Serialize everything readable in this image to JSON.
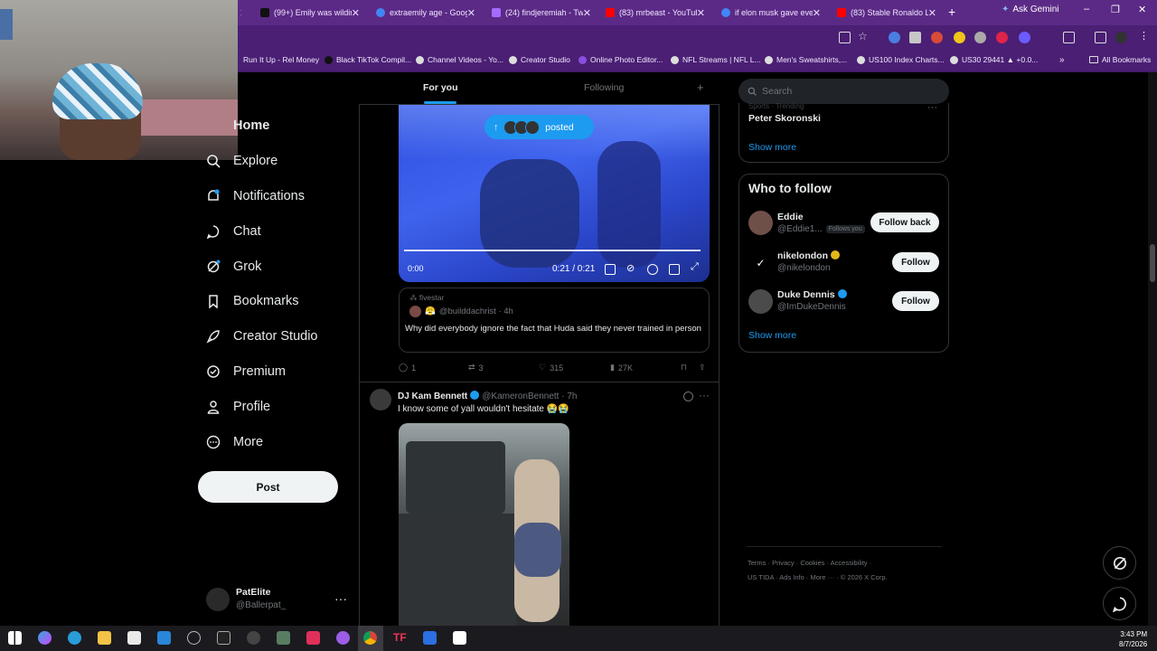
{
  "browser": {
    "tabs": [
      {
        "title": "(99+) Emily was wildin",
        "color": "#ffffff"
      },
      {
        "title": "extraemily age - Goog",
        "color": "#4285f4"
      },
      {
        "title": "(24) findjeremiah - Tw",
        "color": "#a46bff"
      },
      {
        "title": "(83) mrbeast - YouTub",
        "color": "#ff0000"
      },
      {
        "title": "if elon musk gave ever",
        "color": "#4285f4"
      },
      {
        "title": "(83) Stable Ronaldo Li",
        "color": "#ff0000"
      }
    ],
    "ask_gemini": "Ask Gemini",
    "bookmarks": [
      "Run It Up - Rel Money",
      "Black TikTok Compil...",
      "Channel Videos - Yo...",
      "Creator Studio",
      "Online Photo Editor...",
      "NFL Streams | NFL L...",
      "Men's Sweatshirts,...",
      "US100 Index Charts...",
      "US30 29441 ▲ +0.0...",
      "All Bookmarks"
    ]
  },
  "nav": {
    "items": [
      {
        "label": "Home",
        "icon": "home-icon"
      },
      {
        "label": "Explore",
        "icon": "search-icon"
      },
      {
        "label": "Notifications",
        "icon": "bell-icon",
        "badge": "1"
      },
      {
        "label": "Chat",
        "icon": "chat-icon"
      },
      {
        "label": "Grok",
        "icon": "grok-icon"
      },
      {
        "label": "Bookmarks",
        "icon": "bookmark-icon"
      },
      {
        "label": "Creator Studio",
        "icon": "rocket-icon"
      },
      {
        "label": "Premium",
        "icon": "verified-icon"
      },
      {
        "label": "Profile",
        "icon": "person-icon"
      },
      {
        "label": "More",
        "icon": "more-circle-icon"
      }
    ],
    "post_label": "Post",
    "account": {
      "name": "PatElite",
      "handle": "@Ballerpat_"
    }
  },
  "feed": {
    "tabs": {
      "for_you": "For you",
      "following": "Following",
      "add": "+"
    },
    "posted_pill": "posted",
    "video": {
      "time": "0:21 / 0:21",
      "start": "0:00"
    },
    "quote": {
      "context": "fivestar",
      "user": "@builddachrist · 4h",
      "text": "Why did everybody ignore the fact that Huda said they never trained in person"
    },
    "actions": {
      "replies": "1",
      "reposts": "3",
      "likes": "315",
      "views": "27K"
    },
    "tweet": {
      "name": "DJ Kam Bennett",
      "handle": "@KameronBennett · 7h",
      "text": "I know some of yall wouldn't hesitate 😭😭"
    }
  },
  "right": {
    "search_placeholder": "Search",
    "trend": {
      "subtitle": "Sports · Trending",
      "name": "Peter Skoronski"
    },
    "show_more": "Show more",
    "who_to_follow": {
      "title": "Who to follow",
      "users": [
        {
          "name": "Eddie",
          "handle": "@Eddie1...",
          "follows_you": "Follows you",
          "button": "Follow back",
          "verified": false
        },
        {
          "name": "nikelondon",
          "handle": "@nikelondon",
          "button": "Follow",
          "verified": true
        },
        {
          "name": "Duke Dennis",
          "handle": "@ImDukeDennis",
          "button": "Follow",
          "verified": true
        }
      ],
      "show_more": "Show more"
    },
    "footer": {
      "line1": "Terms  ·  Privacy  ·  Cookies  ·  Accessibility  ·",
      "line2": "US TIDA  ·  Ads Info  ·  More ···  ·  © 2026 X Corp."
    }
  },
  "taskbar": {
    "time": "3:43 PM",
    "date": "8/7/2026"
  }
}
